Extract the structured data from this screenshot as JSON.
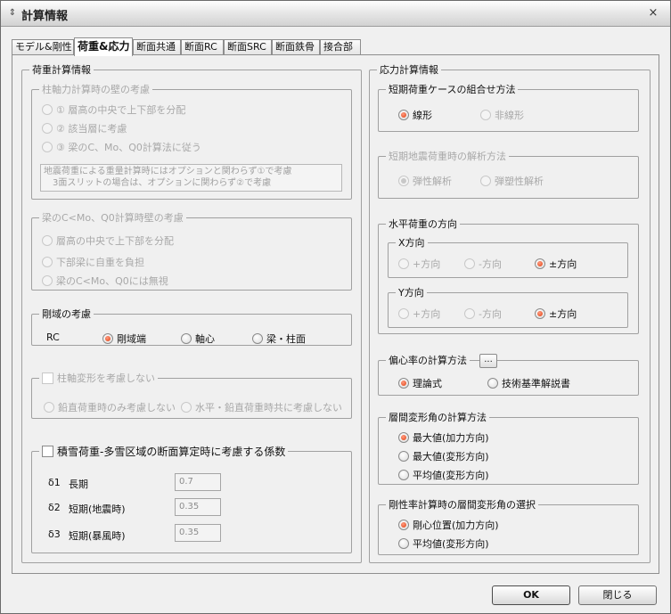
{
  "window": {
    "title": "計算情報",
    "title_icon": "chevron-updown-icon",
    "close_glyph": "×"
  },
  "tabs": [
    {
      "label": "モデル&剛性",
      "active": false
    },
    {
      "label": "荷重&応力",
      "active": true
    },
    {
      "label": "断面共通",
      "active": false
    },
    {
      "label": "断面RC",
      "active": false
    },
    {
      "label": "断面SRC",
      "active": false
    },
    {
      "label": "断面鉄骨",
      "active": false
    },
    {
      "label": "接合部",
      "active": false
    }
  ],
  "load_info": {
    "title": "荷重計算情報",
    "wall_axial": {
      "title": "柱軸力計算時の壁の考慮",
      "options": [
        "① 層高の中央で上下部を分配",
        "② 該当層に考慮",
        "③ 梁のC、Mo、Q0計算法に従う"
      ],
      "note_line1": "地震荷重による重量計算時にはオプションと関わらず①で考慮",
      "note_line2": "3面スリットの場合は、オプションに関わらず②で考慮"
    },
    "beam_wall": {
      "title": "梁のC<Mo、Q0計算時壁の考慮",
      "options": [
        "層高の中央で上下部を分配",
        "下部梁に自重を負担",
        "梁のC<Mo、Q0には無視"
      ]
    },
    "rigid_zone": {
      "title": "剛域の考慮",
      "row_label": "RC",
      "options": [
        "剛域端",
        "軸心",
        "梁・柱面"
      ],
      "selected": "剛域端"
    },
    "column_axial_deform": {
      "title": "柱軸変形を考慮しない",
      "options": [
        "鉛直荷重時のみ考慮しない",
        "水平・鉛直荷重時共に考慮しない"
      ]
    },
    "snow": {
      "title": "積雪荷重-多雪区域の断面算定時に考慮する係数",
      "rows": [
        {
          "symbol": "δ1",
          "label": "長期",
          "value": "0.7"
        },
        {
          "symbol": "δ2",
          "label": "短期(地震時)",
          "value": "0.35"
        },
        {
          "symbol": "δ3",
          "label": "短期(暴風時)",
          "value": "0.35"
        }
      ]
    }
  },
  "stress_info": {
    "title": "応力計算情報",
    "short_combo": {
      "title": "短期荷重ケースの組合せ方法",
      "options": [
        "線形",
        "非線形"
      ],
      "selected": "線形"
    },
    "short_seismic": {
      "title": "短期地震荷重時の解析方法",
      "options": [
        "弾性解析",
        "弾塑性解析"
      ],
      "selected": "弾性解析"
    },
    "horizontal_dir": {
      "title": "水平荷重の方向",
      "x": {
        "title": "X方向",
        "options": [
          "+方向",
          "-方向",
          "±方向"
        ],
        "selected": "±方向"
      },
      "y": {
        "title": "Y方向",
        "options": [
          "+方向",
          "-方向",
          "±方向"
        ],
        "selected": "±方向"
      }
    },
    "eccentricity": {
      "title": "偏心率の計算方法",
      "button": "...",
      "options": [
        "理論式",
        "技術基準解説書"
      ],
      "selected": "理論式"
    },
    "story_drift": {
      "title": "層間変形角の計算方法",
      "options": [
        "最大値(加力方向)",
        "最大値(変形方向)",
        "平均値(変形方向)"
      ],
      "selected": "最大値(加力方向)"
    },
    "rigidity_drift": {
      "title": "剛性率計算時の層間変形角の選択",
      "options": [
        "剛心位置(加力方向)",
        "平均値(変形方向)"
      ],
      "selected": "剛心位置(加力方向)"
    }
  },
  "buttons": {
    "ok": "OK",
    "close": "閉じる"
  }
}
